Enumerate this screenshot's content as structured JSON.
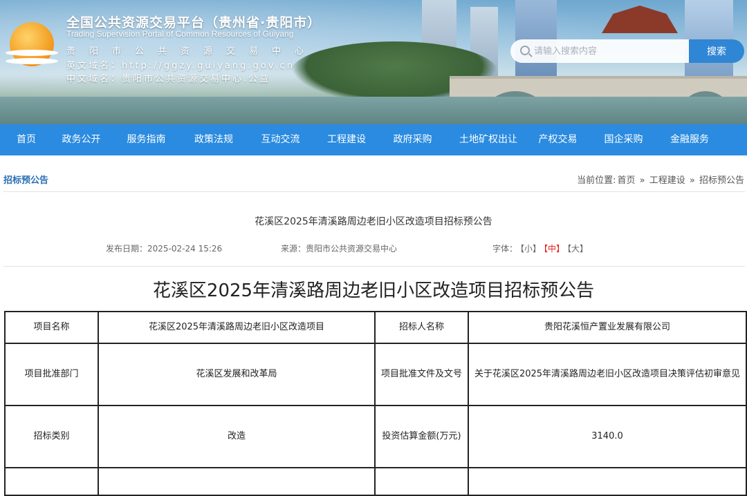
{
  "header": {
    "title_cn": "全国公共资源交易平台（贵州省·贵阳市）",
    "title_en": "Trading Supervision Portal of Common Resources of Guiyang",
    "center_name": "贵阳市公共资源交易中心",
    "en_domain_label": "英文域名：",
    "en_domain": "http://ggzy.guiyang.gov.cn",
    "cn_domain_label": "中文域名：",
    "cn_domain": "贵阳市公共资源交易中心.公益"
  },
  "search": {
    "placeholder": "请输入搜索内容",
    "button_label": "搜索"
  },
  "nav": {
    "items": [
      "首页",
      "政务公开",
      "服务指南",
      "政策法规",
      "互动交流",
      "工程建设",
      "政府采购",
      "土地矿权出让",
      "产权交易",
      "国企采购",
      "金融服务"
    ]
  },
  "breadcrumb": {
    "section_title": "招标预公告",
    "prefix": "当前位置:",
    "path": [
      "首页",
      "工程建设",
      "招标预公告"
    ],
    "separator": "»"
  },
  "article": {
    "title": "花溪区2025年清溪路周边老旧小区改造项目招标预公告",
    "publish_label": "发布日期：",
    "publish_date": "2025-02-24 15:26",
    "source_label": "来源：",
    "source": "贵阳市公共资源交易中心",
    "font_label": "字体：",
    "font_small": "【小】",
    "font_medium": "【中】",
    "font_large": "【大】",
    "heading": "花溪区2025年清溪路周边老旧小区改造项目招标预公告"
  },
  "table": {
    "rows": [
      [
        "项目名称",
        "花溪区2025年清溪路周边老旧小区改造项目",
        "招标人名称",
        "贵阳花溪恒产置业发展有限公司"
      ],
      [
        "项目批准部门",
        "花溪区发展和改革局",
        "项目批准文件及文号",
        "关于花溪区2025年清溪路周边老旧小区改造项目决策评估初审意见"
      ],
      [
        "招标类别",
        "改造",
        "投资估算金额(万元)",
        "3140.0"
      ]
    ]
  },
  "colors": {
    "nav_bg": "#2a8be0",
    "search_button": "#2f86d4",
    "active_font": "#e02020",
    "crumb_title": "#2a6fb5"
  }
}
